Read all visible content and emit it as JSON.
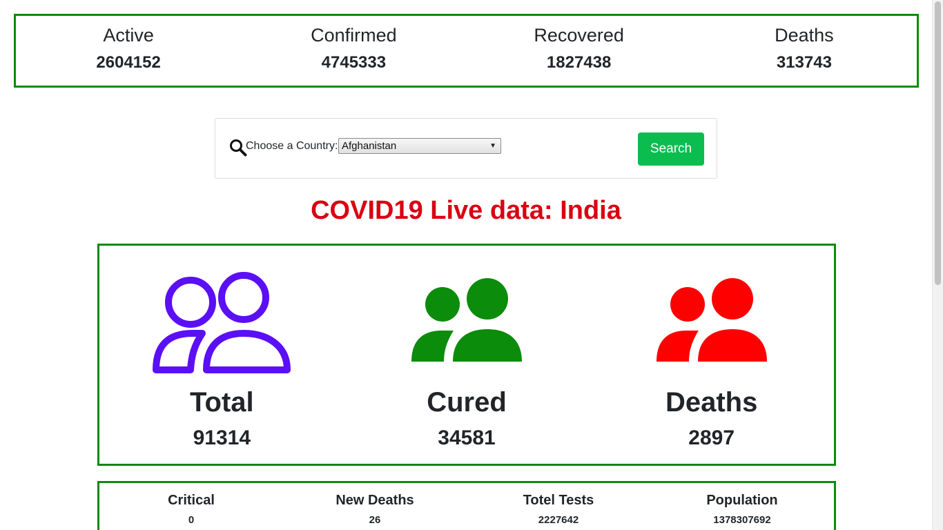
{
  "global": {
    "stats": [
      {
        "label": "Active",
        "value": "2604152"
      },
      {
        "label": "Confirmed",
        "value": "4745333"
      },
      {
        "label": "Recovered",
        "value": "1827438"
      },
      {
        "label": "Deaths",
        "value": "313743"
      }
    ]
  },
  "search": {
    "label": "Choose a Country:",
    "selected_country": "Afghanistan",
    "button_label": "Search",
    "icon": "search-icon"
  },
  "headline": "COVID19 Live data: India",
  "country": {
    "cards": [
      {
        "label": "Total",
        "value": "91314",
        "icon": "users-outline-icon",
        "color": "#5b0ff5"
      },
      {
        "label": "Cured",
        "value": "34581",
        "icon": "users-solid-icon",
        "color": "#0b8c0b"
      },
      {
        "label": "Deaths",
        "value": "2897",
        "icon": "users-solid-icon",
        "color": "#ff0000"
      }
    ]
  },
  "details": [
    {
      "label": "Critical",
      "value": "0"
    },
    {
      "label": "New Deaths",
      "value": "26"
    },
    {
      "label": "Totel Tests",
      "value": "2227642"
    },
    {
      "label": "Population",
      "value": "1378307692"
    }
  ],
  "colors": {
    "border_green": "#0c8a0c",
    "headline_red": "#d90012",
    "button_green": "#0bbd4f"
  }
}
